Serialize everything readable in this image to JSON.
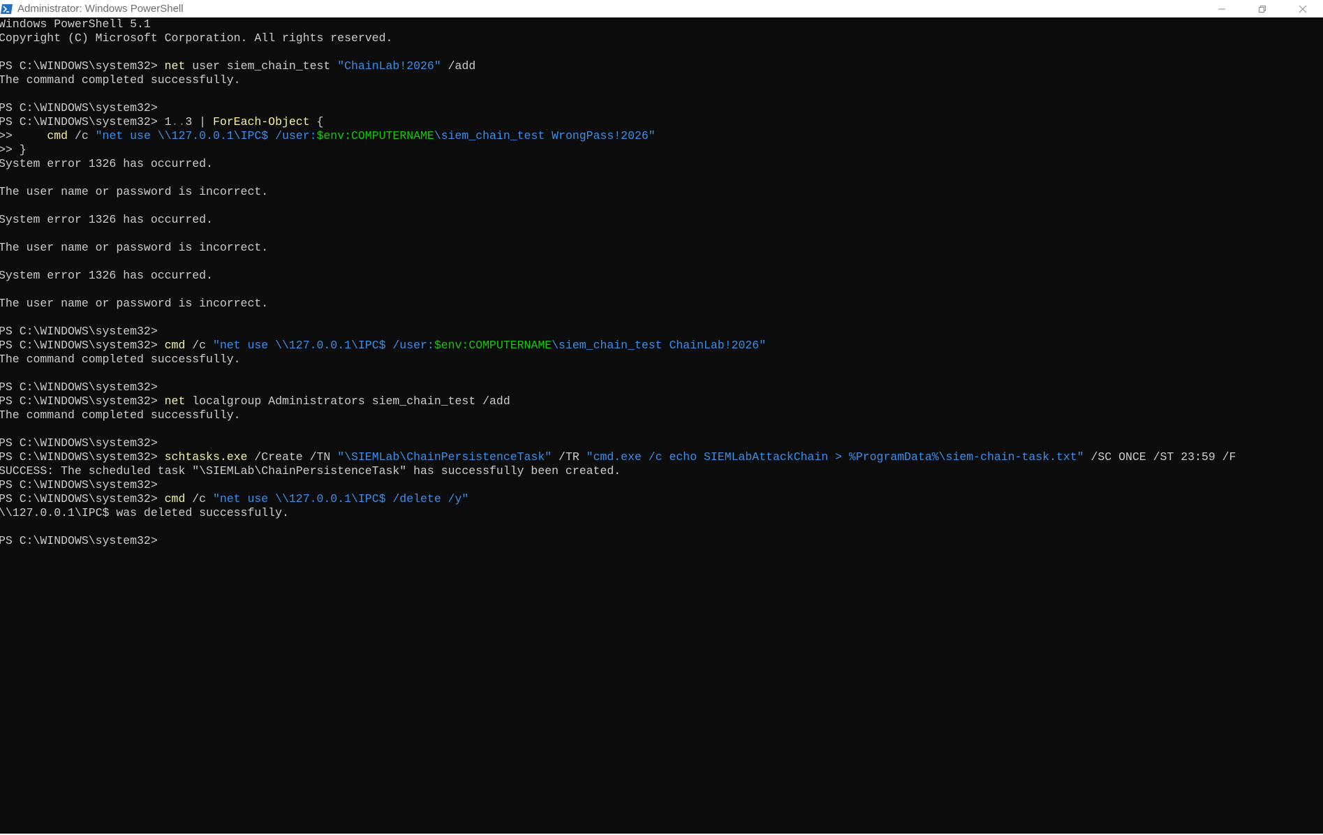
{
  "window": {
    "title": "Administrator: Windows PowerShell",
    "icon": "powershell-icon",
    "controls": [
      "minimize-icon",
      "restore-icon",
      "close-icon"
    ]
  },
  "colors": {
    "background": "#0c0c0c",
    "foreground": "#cccccc",
    "command": "#f9f1a5",
    "string": "#3b8eea",
    "variable": "#16c60c",
    "operator": "#767676",
    "titlebar": "#ffffff"
  },
  "console": {
    "lines": [
      [
        {
          "t": "Windows PowerShell 5.1",
          "c": "plain"
        }
      ],
      [
        {
          "t": "Copyright (C) Microsoft Corporation. All rights reserved.",
          "c": "plain"
        }
      ],
      [],
      [
        {
          "t": "PS C:\\WINDOWS\\system32> ",
          "c": "plain"
        },
        {
          "t": "net",
          "c": "cmd"
        },
        {
          "t": " user siem_chain_test ",
          "c": "plain"
        },
        {
          "t": "\"ChainLab!2026\"",
          "c": "str"
        },
        {
          "t": " /add",
          "c": "plain"
        }
      ],
      [
        {
          "t": "The command completed successfully.",
          "c": "plain"
        }
      ],
      [],
      [
        {
          "t": "PS C:\\WINDOWS\\system32>",
          "c": "plain"
        }
      ],
      [
        {
          "t": "PS C:\\WINDOWS\\system32> ",
          "c": "plain"
        },
        {
          "t": "1",
          "c": "plain"
        },
        {
          "t": "..",
          "c": "op"
        },
        {
          "t": "3 | ",
          "c": "plain"
        },
        {
          "t": "ForEach-Object",
          "c": "cmd"
        },
        {
          "t": " {",
          "c": "plain"
        }
      ],
      [
        {
          "t": ">>     ",
          "c": "plain"
        },
        {
          "t": "cmd",
          "c": "cmd"
        },
        {
          "t": " /c ",
          "c": "plain"
        },
        {
          "t": "\"net use \\\\127.0.0.1\\IPC$ /user:",
          "c": "str"
        },
        {
          "t": "$env:COMPUTERNAME",
          "c": "var"
        },
        {
          "t": "\\siem_chain_test WrongPass!2026\"",
          "c": "str"
        }
      ],
      [
        {
          "t": ">> }",
          "c": "plain"
        }
      ],
      [
        {
          "t": "System error 1326 has occurred.",
          "c": "plain"
        }
      ],
      [],
      [
        {
          "t": "The user name or password is incorrect.",
          "c": "plain"
        }
      ],
      [],
      [
        {
          "t": "System error 1326 has occurred.",
          "c": "plain"
        }
      ],
      [],
      [
        {
          "t": "The user name or password is incorrect.",
          "c": "plain"
        }
      ],
      [],
      [
        {
          "t": "System error 1326 has occurred.",
          "c": "plain"
        }
      ],
      [],
      [
        {
          "t": "The user name or password is incorrect.",
          "c": "plain"
        }
      ],
      [],
      [
        {
          "t": "PS C:\\WINDOWS\\system32>",
          "c": "plain"
        }
      ],
      [
        {
          "t": "PS C:\\WINDOWS\\system32> ",
          "c": "plain"
        },
        {
          "t": "cmd",
          "c": "cmd"
        },
        {
          "t": " /c ",
          "c": "plain"
        },
        {
          "t": "\"net use \\\\127.0.0.1\\IPC$ /user:",
          "c": "str"
        },
        {
          "t": "$env:COMPUTERNAME",
          "c": "var"
        },
        {
          "t": "\\siem_chain_test ChainLab!2026\"",
          "c": "str"
        }
      ],
      [
        {
          "t": "The command completed successfully.",
          "c": "plain"
        }
      ],
      [],
      [
        {
          "t": "PS C:\\WINDOWS\\system32>",
          "c": "plain"
        }
      ],
      [
        {
          "t": "PS C:\\WINDOWS\\system32> ",
          "c": "plain"
        },
        {
          "t": "net",
          "c": "cmd"
        },
        {
          "t": " localgroup Administrators siem_chain_test /add",
          "c": "plain"
        }
      ],
      [
        {
          "t": "The command completed successfully.",
          "c": "plain"
        }
      ],
      [],
      [
        {
          "t": "PS C:\\WINDOWS\\system32>",
          "c": "plain"
        }
      ],
      [
        {
          "t": "PS C:\\WINDOWS\\system32> ",
          "c": "plain"
        },
        {
          "t": "schtasks.exe",
          "c": "cmd"
        },
        {
          "t": " /Create /TN ",
          "c": "plain"
        },
        {
          "t": "\"\\SIEMLab\\ChainPersistenceTask\"",
          "c": "str"
        },
        {
          "t": " /TR ",
          "c": "plain"
        },
        {
          "t": "\"cmd.exe /c echo SIEMLabAttackChain > %ProgramData%\\siem-chain-task.txt\"",
          "c": "str"
        },
        {
          "t": " /SC ONCE /ST 23:59 /F",
          "c": "plain"
        }
      ],
      [
        {
          "t": "SUCCESS: The scheduled task \"\\SIEMLab\\ChainPersistenceTask\" has successfully been created.",
          "c": "plain"
        }
      ],
      [
        {
          "t": "PS C:\\WINDOWS\\system32>",
          "c": "plain"
        }
      ],
      [
        {
          "t": "PS C:\\WINDOWS\\system32> ",
          "c": "plain"
        },
        {
          "t": "cmd",
          "c": "cmd"
        },
        {
          "t": " /c ",
          "c": "plain"
        },
        {
          "t": "\"net use \\\\127.0.0.1\\IPC$ /delete /y\"",
          "c": "str"
        }
      ],
      [
        {
          "t": "\\\\127.0.0.1\\IPC$ was deleted successfully.",
          "c": "plain"
        }
      ],
      [],
      [
        {
          "t": "PS C:\\WINDOWS\\system32>",
          "c": "plain"
        }
      ]
    ]
  }
}
